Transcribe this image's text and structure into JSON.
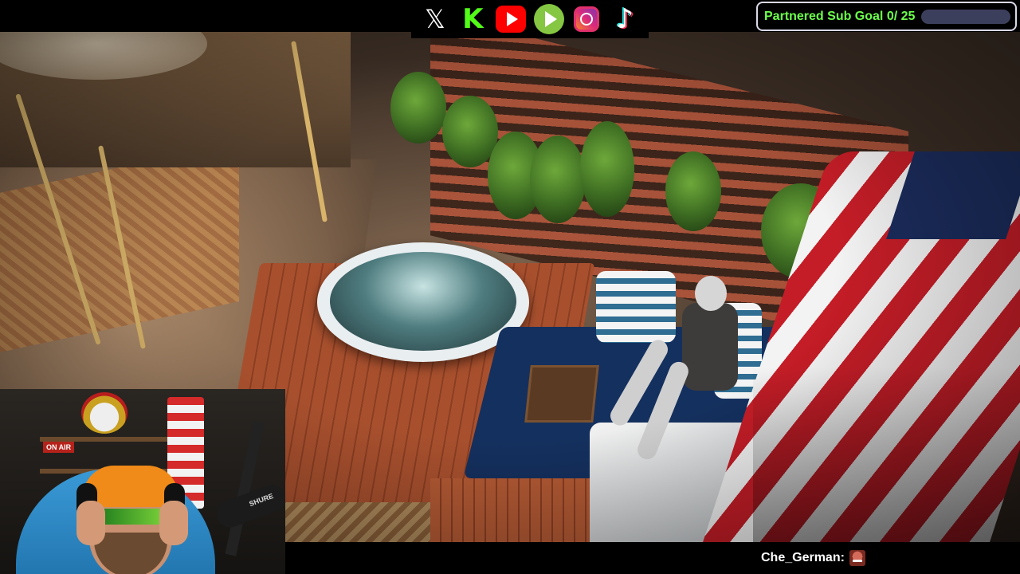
{
  "stream": {
    "sub_goal": {
      "label": "Partnered Sub Goal 0/ 25",
      "current": 0,
      "target": 25,
      "progress_fraction": 0.0,
      "fill_color": "#6dff4d",
      "track_color": "#3c3f5c"
    },
    "socials": [
      {
        "name": "x-icon",
        "glyph": "𝕏"
      },
      {
        "name": "kick-icon",
        "glyph": "K"
      },
      {
        "name": "youtube-icon",
        "glyph": ""
      },
      {
        "name": "rumble-icon",
        "glyph": ""
      },
      {
        "name": "instagram-icon",
        "glyph": ""
      },
      {
        "name": "tiktok-icon",
        "glyph": "♪"
      }
    ],
    "webcam": {
      "on_air_sign": "ON AIR",
      "mic_brand": "SHURE"
    },
    "chat": [
      {
        "user": "Che_German:",
        "emote": "face-emote"
      }
    ]
  }
}
